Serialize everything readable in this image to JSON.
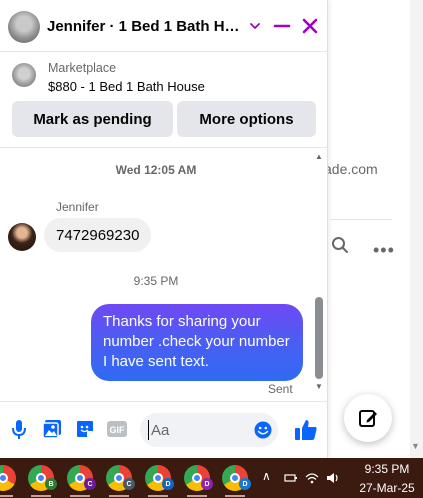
{
  "background_page": {
    "visible_text": "ade.com"
  },
  "chat": {
    "header": {
      "title": "Jennifer · 1 Bed 1 Bath Hou..."
    },
    "listing": {
      "label": "Marketplace",
      "title": "$880 - 1 Bed 1 Bath House",
      "buttons": {
        "mark_pending": "Mark as pending",
        "more_options": "More options"
      }
    },
    "messages": {
      "timestamp_1": "Wed 12:05 AM",
      "sender_name": "Jennifer",
      "received_text": "7472969230",
      "timestamp_2": "9:35 PM",
      "sent_text": "Thanks for sharing your number .check your number I have sent text.",
      "sent_status": "Sent"
    },
    "composer": {
      "input_placeholder": "Aa",
      "input_value": ""
    },
    "accent_color": "#a400c7",
    "bubble_color": "#3a6cf2"
  },
  "taskbar": {
    "apps": [
      {
        "badge": "",
        "badge_color": ""
      },
      {
        "badge": "B",
        "badge_color": "#2e7d32"
      },
      {
        "badge": "C",
        "badge_color": "#6a1b9a"
      },
      {
        "badge": "C",
        "badge_color": "#455a64"
      },
      {
        "badge": "D",
        "badge_color": "#1565c0"
      },
      {
        "badge": "D",
        "badge_color": "#8e24aa"
      },
      {
        "badge": "D",
        "badge_color": "#1976d2"
      }
    ],
    "time": "9:35 PM",
    "date": "27-Mar-25"
  }
}
